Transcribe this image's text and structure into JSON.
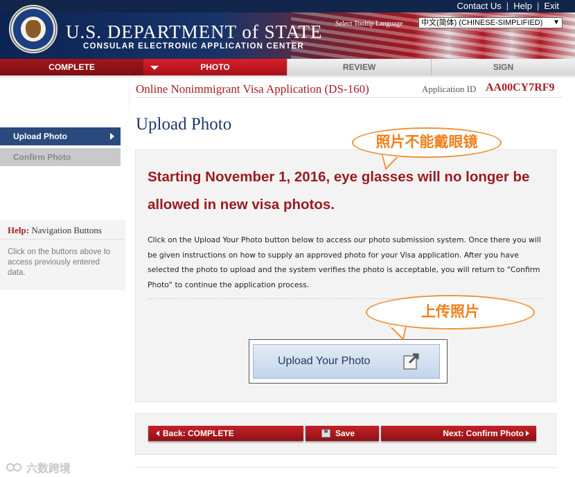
{
  "header": {
    "links": [
      "Contact Us",
      "Help",
      "Exit"
    ],
    "department_title": "U.S. DEPARTMENT of STATE",
    "department_subtitle": "CONSULAR ELECTRONIC APPLICATION CENTER",
    "tooltip_language_label": "Select Tooltip Language",
    "tooltip_language_value": "中文(简体)  (CHINESE-SIMPLIFIED)"
  },
  "steps": [
    {
      "label": "COMPLETE",
      "state": "complete"
    },
    {
      "label": "PHOTO",
      "state": "active"
    },
    {
      "label": "REVIEW",
      "state": "todo"
    },
    {
      "label": "SIGN",
      "state": "todo"
    }
  ],
  "application": {
    "title": "Online Nonimmigrant Visa Application (DS-160)",
    "id_label": "Application ID",
    "id_value": "AA00CY7RF9"
  },
  "page_title": "Upload Photo",
  "sidebar": {
    "items": [
      {
        "label": "Upload Photo",
        "active": true
      },
      {
        "label": "Confirm Photo",
        "active": false
      }
    ],
    "help": {
      "prefix": "Help:",
      "title": "Navigation Buttons",
      "text": "Click on the buttons above to access previously entered data."
    }
  },
  "content": {
    "warning": "Starting November 1, 2016, eye glasses will no longer be allowed in new visa photos.",
    "instructions": "Click on the Upload Your Photo button below to access our photo submission system. Once there you will be given instructions on how to supply an approved photo for your Visa application. After you have selected the photo to upload and the system verifies the photo is acceptable, you will return to “Confirm Photo” to continue the application process.",
    "upload_button_label": "Upload Your Photo"
  },
  "callouts": {
    "no_glasses": "照片不能戴眼镜",
    "upload_photo": "上传照片"
  },
  "nav": {
    "back_label": "Back: COMPLETE",
    "save_label": "Save",
    "next_label": "Next: Confirm Photo"
  },
  "watermark": "六数跨境",
  "colors": {
    "header_navy": "#12254a",
    "accent_red": "#a61d22",
    "sidebar_active": "#2a4a7e",
    "callout_orange": "#ef7f1a"
  }
}
